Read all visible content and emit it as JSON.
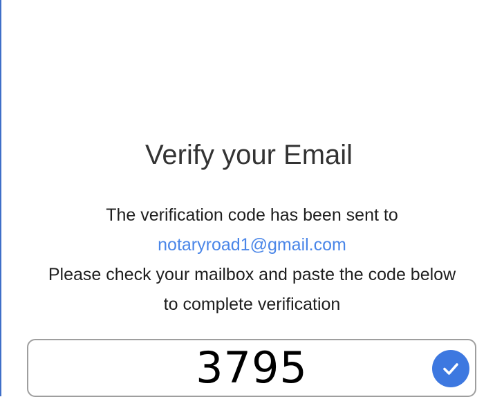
{
  "page": {
    "title": "Verify your Email",
    "message_line1": "The verification code has been sent to",
    "email": "notaryroad1@gmail.com",
    "message_line2": "Please check your mailbox and paste the code below",
    "message_line3": "to complete verification"
  },
  "code_field": {
    "value": "3795",
    "valid": true
  },
  "icons": {
    "valid": "check-circle-icon"
  },
  "colors": {
    "accent": "#3d78e0",
    "email_link": "#4a86e8",
    "border": "#9e9e9e",
    "left_rule": "#3f6fc8"
  }
}
